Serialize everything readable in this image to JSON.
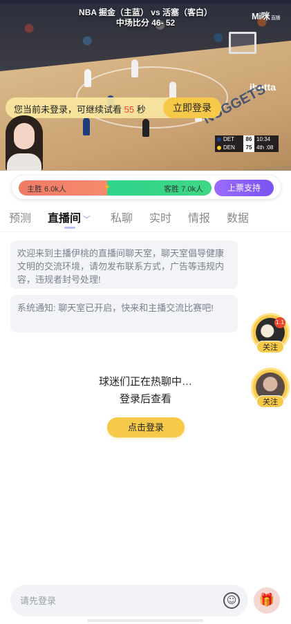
{
  "video": {
    "title_line1": "NBA 掘金（主蓝） vs 活塞（客白）",
    "title_line2": "中场比分 46- 52",
    "watermark": "Mi咪",
    "watermark_small": "直播",
    "login_banner": {
      "text_before": "您当前未登录，可继续试看",
      "seconds": "55",
      "text_after": "秒",
      "button": "立即登录"
    },
    "scoreboard": {
      "rows": [
        {
          "team": "DET",
          "points": "86",
          "misc": "10:34",
          "color": "#1d428a"
        },
        {
          "team": "DEN",
          "points": "75",
          "misc": "4th :08",
          "color": "#fec524"
        }
      ]
    },
    "court_text": {
      "ibotta": "ibotta",
      "nuggets": "NUGGETS"
    }
  },
  "support": {
    "home_label": "主胜 6.0k人",
    "away_label": "客胜 7.0k人",
    "home_share": 0.46,
    "vote_button": "上票支持",
    "vs_icon": "✦"
  },
  "tabs": [
    {
      "label": "预测",
      "active": false
    },
    {
      "label": "直播间",
      "active": true
    },
    {
      "label": "私聊",
      "active": false
    },
    {
      "label": "实时",
      "active": false
    },
    {
      "label": "情报",
      "active": false
    },
    {
      "label": "数据",
      "active": false
    }
  ],
  "tab_chevron": "﹀",
  "chat": {
    "welcome": "欢迎来到主播伊桃的直播间聊天室，聊天室倡导健康文明的交流环境，请勿发布联系方式，广告等违规内容，违规者封号处理!",
    "system": "系统通知: 聊天室已开启，快来和主播交流比赛吧!",
    "hot_line1": "球迷们正在热聊中…",
    "hot_line2": "登录后查看",
    "login_button": "点击登录"
  },
  "float_avatars": [
    {
      "follow": "关注",
      "badge": "1.1"
    },
    {
      "follow": "关注"
    }
  ],
  "input": {
    "placeholder": "请先登录",
    "emoji_icon": "☺",
    "gift_icon": "🎁"
  },
  "colors": {
    "accent_yellow": "#f7c948",
    "vote_purple": "#7a52f0",
    "home_red": "#f07a67",
    "away_green": "#2fd38a",
    "countdown_red": "#ff3b30"
  }
}
